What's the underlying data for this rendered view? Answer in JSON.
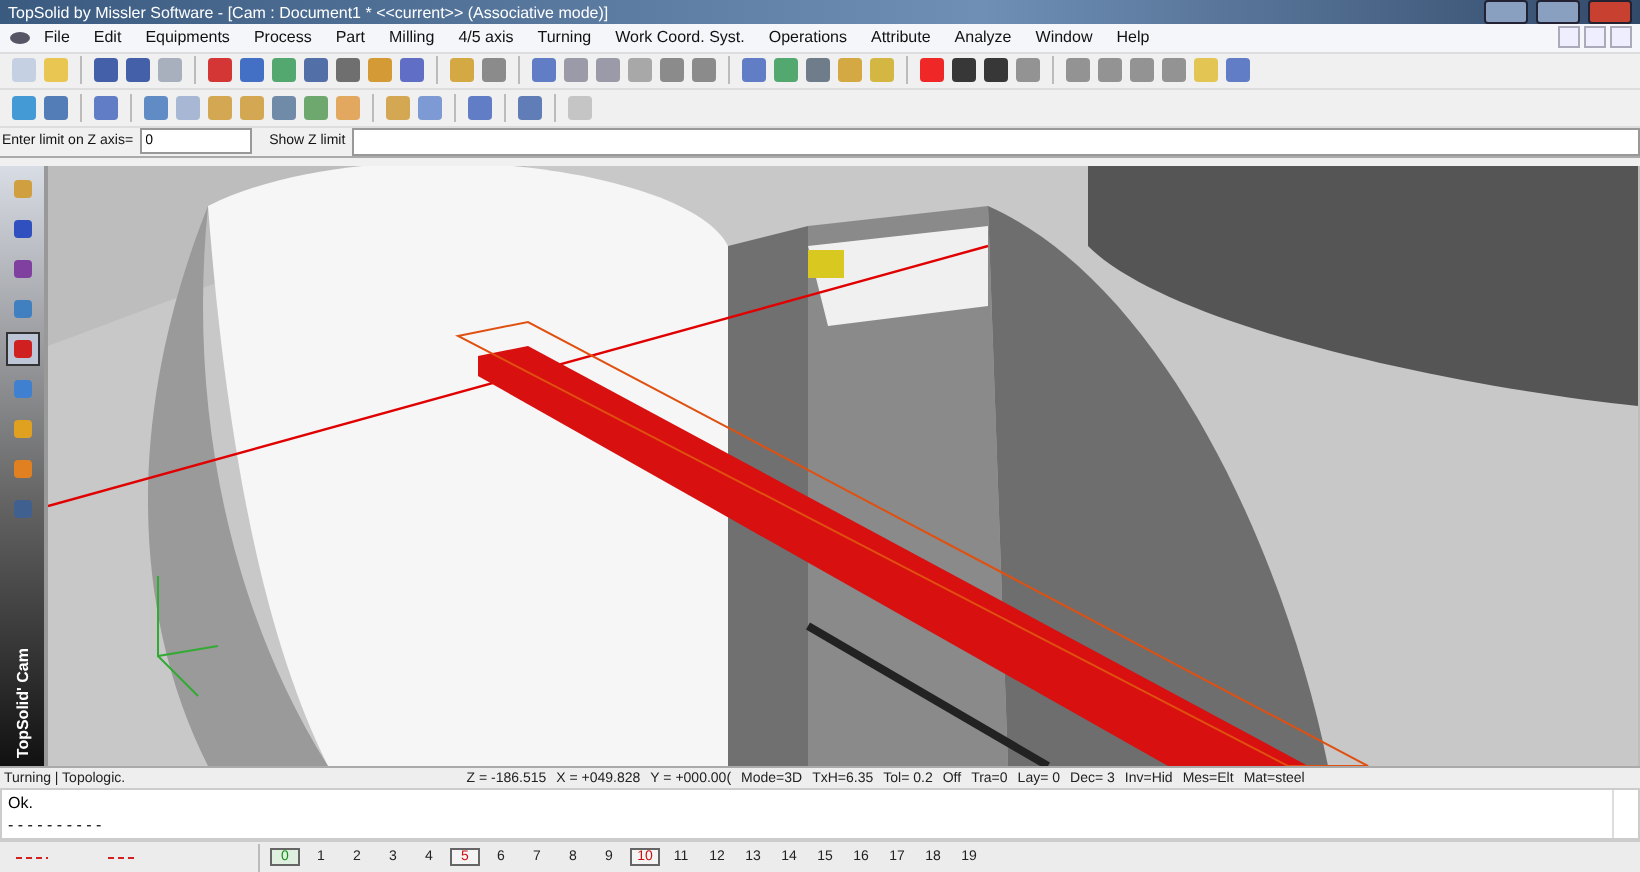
{
  "window": {
    "title": "TopSolid by Missler Software - [Cam : Document1 *  <<current>> (Associative mode)]"
  },
  "menu": [
    "File",
    "Edit",
    "Equipments",
    "Process",
    "Part",
    "Milling",
    "4/5 axis",
    "Turning",
    "Work Coord. Syst.",
    "Operations",
    "Attribute",
    "Analyze",
    "Window",
    "Help"
  ],
  "input_bar": {
    "label": "Enter limit on Z axis=",
    "value": "0",
    "show_label": "Show Z limit"
  },
  "sidebar": {
    "items": [
      {
        "selected": false
      },
      {
        "selected": false
      },
      {
        "selected": false
      },
      {
        "selected": false
      },
      {
        "selected": true
      },
      {
        "selected": false
      },
      {
        "selected": false
      },
      {
        "selected": false
      },
      {
        "selected": false
      }
    ],
    "brand": "TopSolid' Cam"
  },
  "status_bar": {
    "mode": "Turning | Topologic.",
    "readings": [
      "Z = -186.515",
      "X = +049.828",
      "Y = +000.00(",
      "Mode=3D",
      "TxH=6.35",
      "Tol=  0.2",
      "Off",
      "Tra=0",
      "Lay=  0",
      "Dec= 3",
      "Inv=Hid",
      "Mes=Elt",
      "Mat=steel"
    ]
  },
  "command_area": {
    "lines": [
      "Ok.",
      "- - - - - - - - - -"
    ]
  },
  "layers": [
    {
      "label": "0",
      "kind": "current"
    },
    {
      "label": "1",
      "kind": "plain"
    },
    {
      "label": "2",
      "kind": "plain"
    },
    {
      "label": "3",
      "kind": "plain"
    },
    {
      "label": "4",
      "kind": "plain"
    },
    {
      "label": "5",
      "kind": "used"
    },
    {
      "label": "6",
      "kind": "plain"
    },
    {
      "label": "7",
      "kind": "plain"
    },
    {
      "label": "8",
      "kind": "plain"
    },
    {
      "label": "9",
      "kind": "plain"
    },
    {
      "label": "10",
      "kind": "marked"
    },
    {
      "label": "11",
      "kind": "plain"
    },
    {
      "label": "12",
      "kind": "plain"
    },
    {
      "label": "13",
      "kind": "plain"
    },
    {
      "label": "14",
      "kind": "plain"
    },
    {
      "label": "15",
      "kind": "plain"
    },
    {
      "label": "16",
      "kind": "plain"
    },
    {
      "label": "17",
      "kind": "plain"
    },
    {
      "label": "18",
      "kind": "plain"
    },
    {
      "label": "19",
      "kind": "plain"
    }
  ]
}
